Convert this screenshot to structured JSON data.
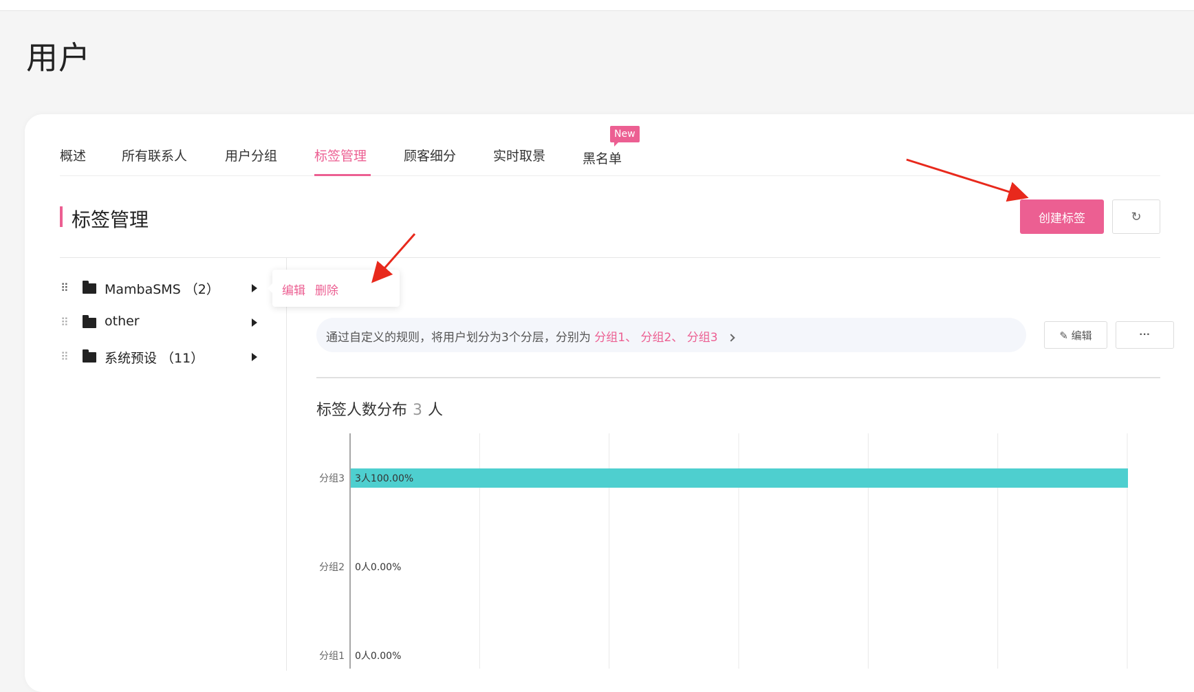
{
  "page": {
    "title": "用户"
  },
  "tabs": [
    {
      "label": "概述",
      "active": false
    },
    {
      "label": "所有联系人",
      "active": false
    },
    {
      "label": "用户分组",
      "active": false
    },
    {
      "label": "标签管理",
      "active": true
    },
    {
      "label": "顾客细分",
      "active": false
    },
    {
      "label": "实时取景",
      "active": false
    },
    {
      "label": "黑名单",
      "active": false,
      "badge": "New"
    }
  ],
  "section": {
    "title": "标签管理",
    "create_label": "创建标签"
  },
  "tree": [
    {
      "label": "MambaSMS （2）"
    },
    {
      "label": "other"
    },
    {
      "label": "系统预设 （11）"
    }
  ],
  "popover": {
    "edit": "编辑",
    "delete": "删除"
  },
  "rule": {
    "prefix": "通过自定义的规则，将用户划分为3个分层，分别为",
    "group1": "分组1",
    "sep1": "、",
    "group2": "分组2",
    "sep2": "、",
    "group3": "分组3",
    "edit_label": "编辑",
    "more_label": "···"
  },
  "distribution": {
    "title": "标签人数分布",
    "count": "3",
    "unit": "人"
  },
  "colors": {
    "accent": "#ec5f92",
    "bar": "#4ecfcf"
  },
  "chart_data": {
    "type": "bar",
    "orientation": "horizontal",
    "categories": [
      "分组3",
      "分组2",
      "分组1"
    ],
    "values": [
      3,
      0,
      0
    ],
    "labels": [
      "3人100.00%",
      "0人0.00%",
      "0人0.00%"
    ],
    "xlim": [
      0,
      3
    ],
    "grid": true
  }
}
